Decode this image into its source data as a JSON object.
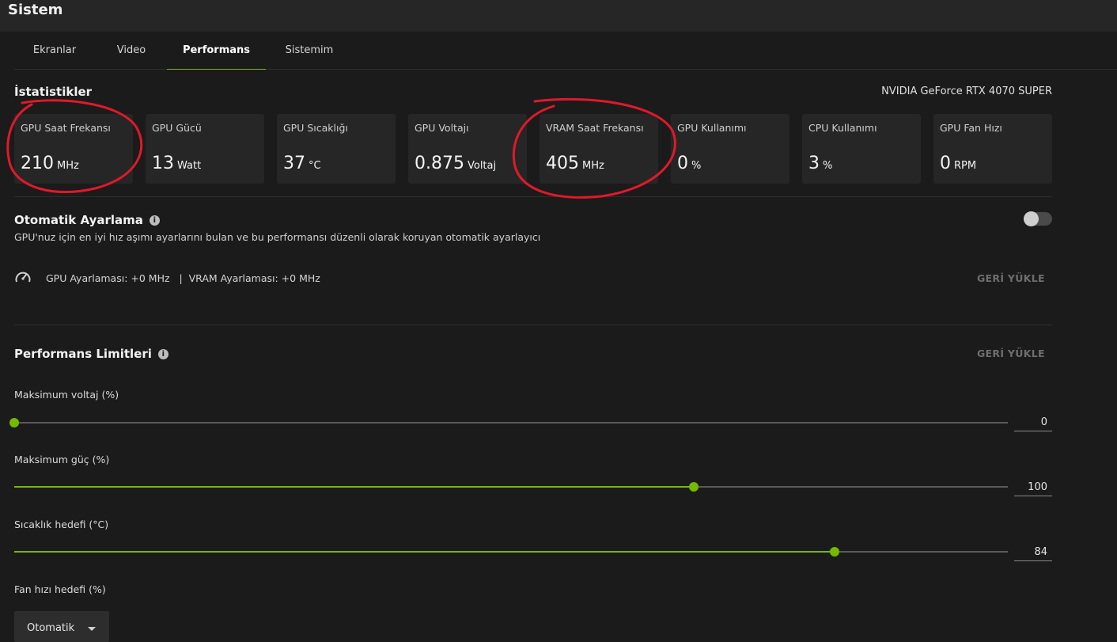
{
  "window": {
    "title": "Sistem"
  },
  "tabs": [
    {
      "label": "Ekranlar"
    },
    {
      "label": "Video"
    },
    {
      "label": "Performans",
      "active": true
    },
    {
      "label": "Sistemim"
    }
  ],
  "stats": {
    "title": "İstatistikler",
    "gpu_name": "NVIDIA GeForce RTX 4070 SUPER",
    "cards": [
      {
        "label": "GPU Saat Frekansı",
        "value": "210",
        "unit": "MHz"
      },
      {
        "label": "GPU Gücü",
        "value": "13",
        "unit": "Watt"
      },
      {
        "label": "GPU Sıcaklığı",
        "value": "37",
        "unit": "°C"
      },
      {
        "label": "GPU Voltajı",
        "value": "0.875",
        "unit": "Voltaj"
      },
      {
        "label": "VRAM Saat Frekansı",
        "value": "405",
        "unit": "MHz"
      },
      {
        "label": "GPU Kullanımı",
        "value": "0",
        "unit": "%"
      },
      {
        "label": "CPU Kullanımı",
        "value": "3",
        "unit": "%"
      },
      {
        "label": "GPU Fan Hızı",
        "value": "0",
        "unit": "RPM"
      }
    ]
  },
  "auto_tune": {
    "title": "Otomatik Ayarlama",
    "info_glyph": "i",
    "description": "GPU'nuz için en iyi hız aşımı ayarlarını bulan ve bu performansı düzenli olarak koruyan otomatik ayarlayıcı",
    "enabled": false,
    "tuning_text": "GPU Ayarlaması: +0 MHz   |  VRAM Ayarlaması: +0 MHz",
    "reset_label": "GERİ YÜKLE"
  },
  "limits": {
    "title": "Performans Limitleri",
    "info_glyph": "i",
    "reset_label": "GERİ YÜKLE",
    "sliders": [
      {
        "label": "Maksimum voltaj (%)",
        "value": "0",
        "fraction": 0.0
      },
      {
        "label": "Maksimum güç (%)",
        "value": "100",
        "fraction": 0.684
      },
      {
        "label": "Sıcaklık hedefi (°C)",
        "value": "84",
        "fraction": 0.826
      }
    ],
    "fan": {
      "label": "Fan hızı hedefi (%)",
      "selected": "Otomatik"
    }
  },
  "colors": {
    "accent": "#76b900",
    "annotation": "#e0192a"
  }
}
